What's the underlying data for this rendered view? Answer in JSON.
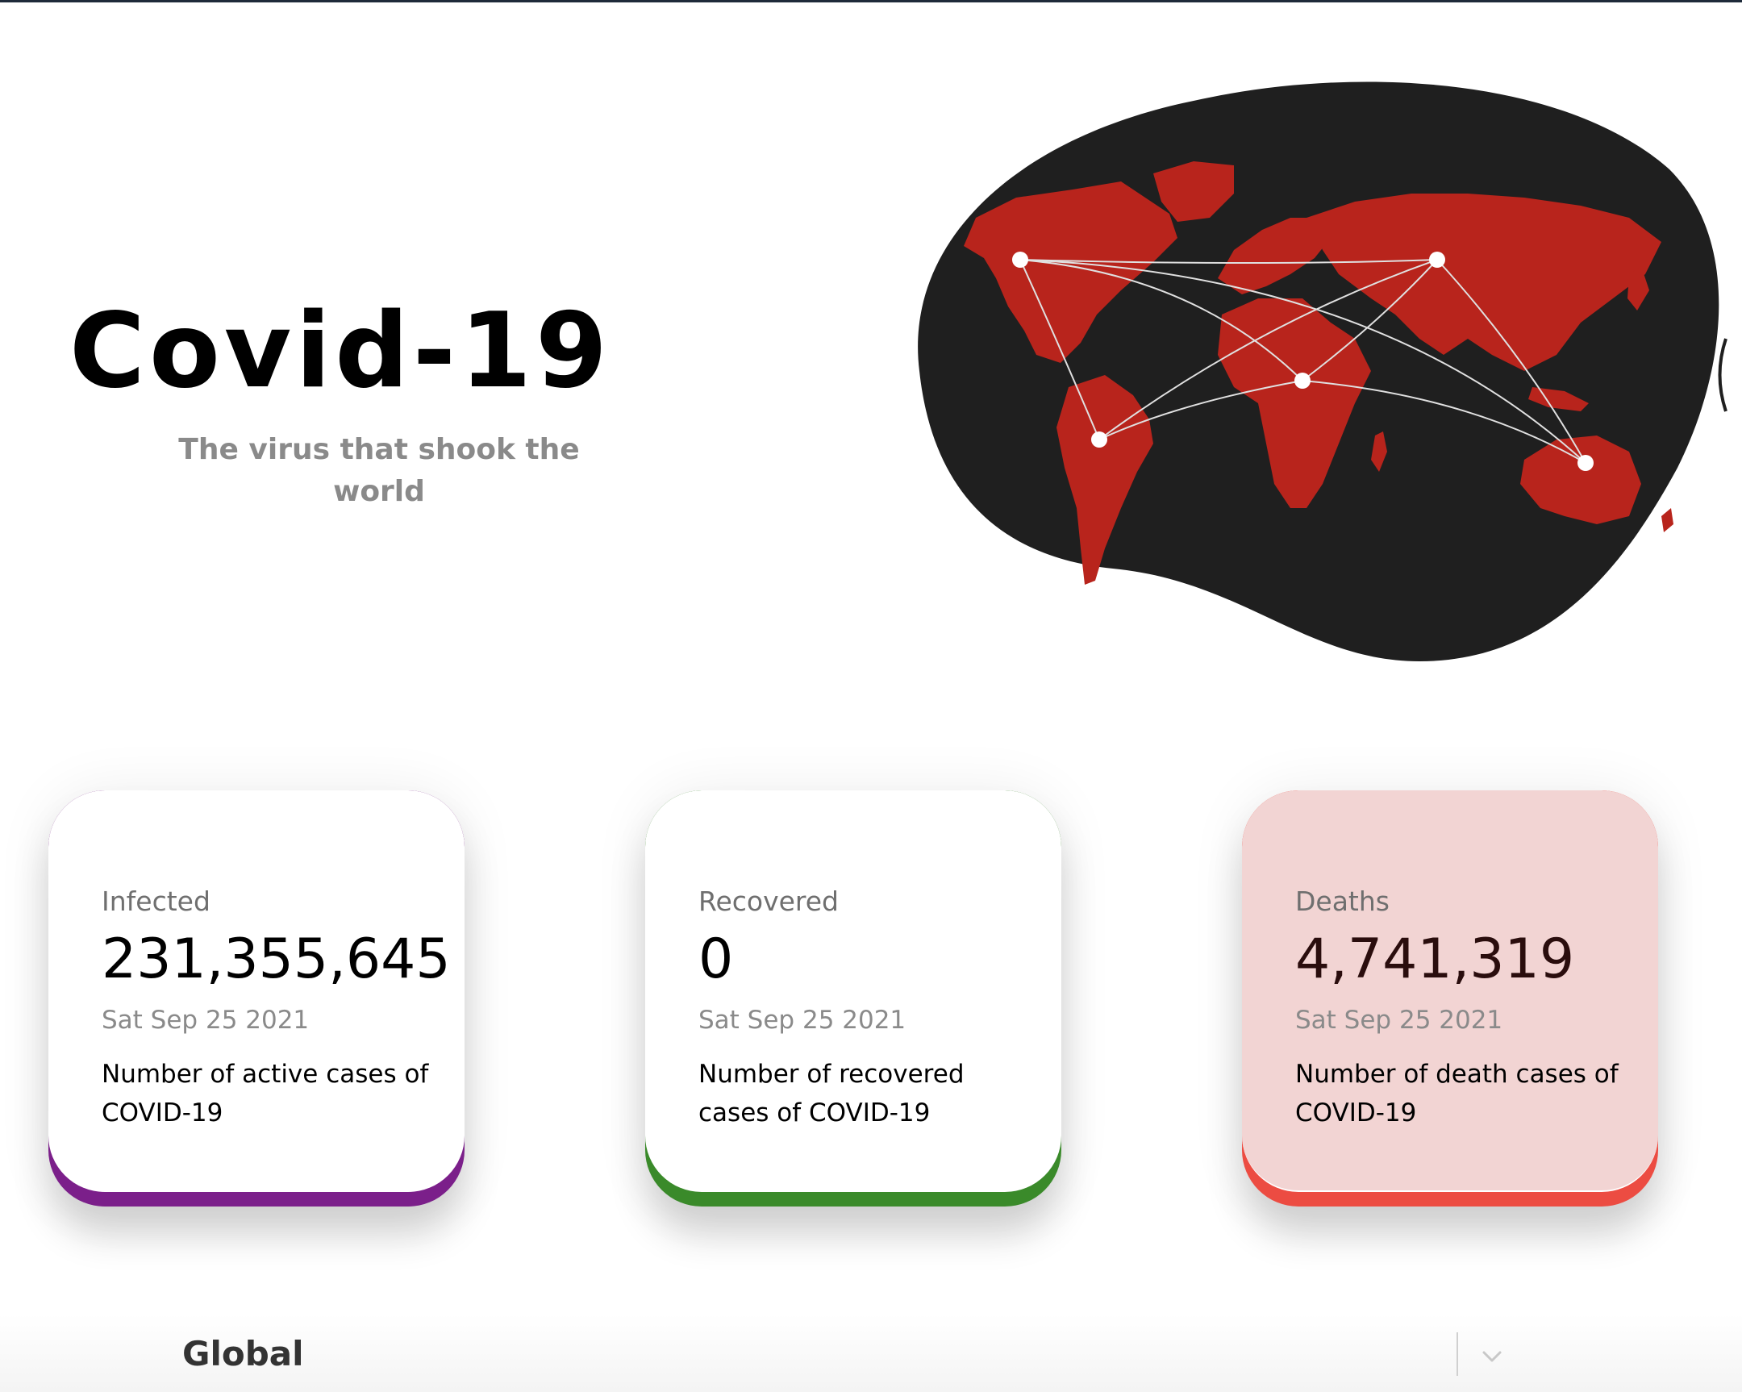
{
  "hero": {
    "title": "Covid-19",
    "subtitle": "The virus that shook the world",
    "map_image": "world-map-network-icon"
  },
  "cards": [
    {
      "label": "Infected",
      "value": "231,355,645",
      "date": "Sat Sep 25 2021",
      "description": "Number of active cases of COVID-19",
      "accent": "#7b1f8a"
    },
    {
      "label": "Recovered",
      "value": "0",
      "date": "Sat Sep 25 2021",
      "description": "Number of recovered cases of COVID-19",
      "accent": "#3a8a2a"
    },
    {
      "label": "Deaths",
      "value": "4,741,319",
      "date": "Sat Sep 25 2021",
      "description": "Number of death cases of COVID-19",
      "accent": "#ec4c42",
      "background": "#f2d4d3"
    }
  ],
  "region_select": {
    "selected": "Global",
    "icon": "chevron-down-icon"
  },
  "colors": {
    "map_blob": "#1f1f1f",
    "continents": "#b8241c",
    "network_nodes": "#ffffff"
  }
}
